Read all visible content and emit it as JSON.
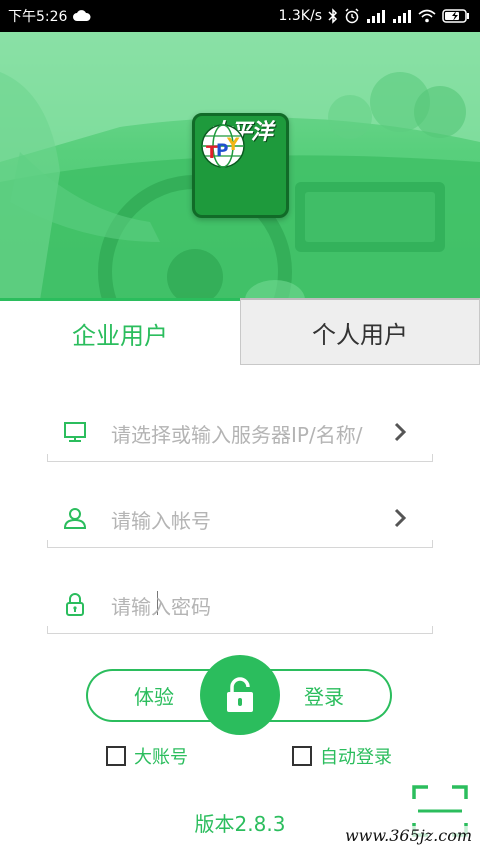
{
  "status_bar": {
    "time": "下午5:26",
    "speed": "1.3K/s",
    "icons": [
      "cloud-icon",
      "bluetooth-icon",
      "alarm-icon",
      "signal-icon",
      "signal-icon",
      "wifi-icon",
      "battery-charging-icon"
    ]
  },
  "hero": {
    "logo": {
      "letters": "TPY",
      "name": "太平洋"
    }
  },
  "tabs": {
    "enterprise": "企业用户",
    "personal": "个人用户",
    "active": "enterprise"
  },
  "form": {
    "server": {
      "placeholder": "请选择或输入服务器IP/名称/",
      "icon": "monitor-icon"
    },
    "account": {
      "placeholder": "请输入帐号",
      "icon": "user-icon"
    },
    "password": {
      "placeholder": "请输入密码",
      "icon": "lock-icon"
    }
  },
  "actions": {
    "trial": "体验",
    "login": "登录"
  },
  "options": {
    "big_account": {
      "label": "大账号",
      "checked": false
    },
    "auto_login": {
      "label": "自动登录",
      "checked": false
    }
  },
  "version": "版本2.8.3",
  "watermark": "www.365jz.com",
  "colors": {
    "accent": "#2bbd5d",
    "hero_green": "#49c96f",
    "logo_green": "#1e9a3c"
  }
}
